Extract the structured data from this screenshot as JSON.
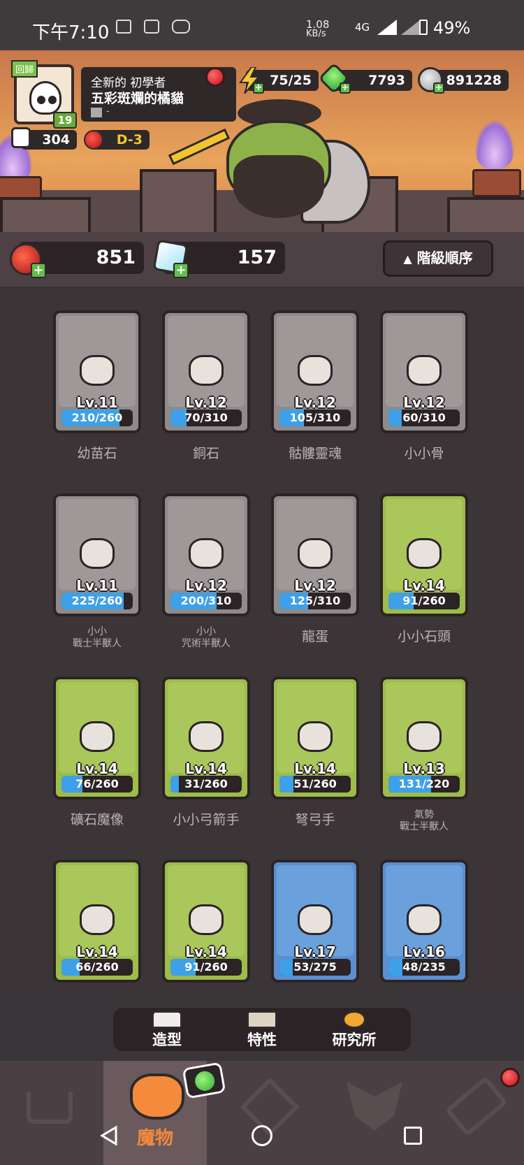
{
  "status_bar": {
    "time": "下午7:10",
    "net_speed": "1.08",
    "net_unit": "KB/s",
    "network": "4G",
    "battery": "49%"
  },
  "profile": {
    "back_badge": "回歸",
    "level": "19",
    "title": "全新的 初學者",
    "name": "五彩斑斕的橘貓",
    "guild": "-",
    "likes": "304",
    "stage": "D-3"
  },
  "currencies": {
    "energy": "75/25",
    "gems": "7793",
    "coins": "891228"
  },
  "resources": {
    "red_orb": "851",
    "crystal": "157",
    "sort_label": "階級順序"
  },
  "cards": [
    {
      "lv": "Lv.11",
      "progress": "210/260",
      "fill": 0.81,
      "name": "幼苗石",
      "color": "gray",
      "icon": "sprout-rock-icon"
    },
    {
      "lv": "Lv.12",
      "progress": "70/310",
      "fill": 0.23,
      "name": "銅石",
      "color": "gray",
      "icon": "crystal-rock-icon"
    },
    {
      "lv": "Lv.12",
      "progress": "105/310",
      "fill": 0.34,
      "name": "骷髏靈魂",
      "color": "gray",
      "icon": "skull-spirit-icon"
    },
    {
      "lv": "Lv.12",
      "progress": "60/310",
      "fill": 0.19,
      "name": "小小骨",
      "color": "gray",
      "icon": "skull-icon"
    },
    {
      "lv": "Lv.11",
      "progress": "225/260",
      "fill": 0.87,
      "name": "小小\n戰士半獸人",
      "color": "gray",
      "icon": "orc-warrior-icon",
      "small": true
    },
    {
      "lv": "Lv.12",
      "progress": "200/310",
      "fill": 0.65,
      "name": "小小\n咒術半獸人",
      "color": "gray",
      "icon": "orc-shaman-icon",
      "small": true
    },
    {
      "lv": "Lv.12",
      "progress": "125/310",
      "fill": 0.4,
      "name": "龍蛋",
      "color": "gray",
      "icon": "dragon-egg-icon"
    },
    {
      "lv": "Lv.14",
      "progress": "91/260",
      "fill": 0.35,
      "name": "小小石頭",
      "color": "green",
      "icon": "stone-icon"
    },
    {
      "lv": "Lv.14",
      "progress": "76/260",
      "fill": 0.29,
      "name": "礦石魔像",
      "color": "green",
      "icon": "ore-golem-icon"
    },
    {
      "lv": "Lv.14",
      "progress": "31/260",
      "fill": 0.12,
      "name": "小小弓箭手",
      "color": "green",
      "icon": "archer-icon"
    },
    {
      "lv": "Lv.14",
      "progress": "51/260",
      "fill": 0.2,
      "name": "弩弓手",
      "color": "green",
      "icon": "crossbow-icon"
    },
    {
      "lv": "Lv.13",
      "progress": "131/220",
      "fill": 0.6,
      "name": "氣勢\n戰士半獸人",
      "color": "green",
      "icon": "orc-berserker-icon",
      "small": true
    },
    {
      "lv": "Lv.14",
      "progress": "66/260",
      "fill": 0.25,
      "name": "",
      "color": "green",
      "icon": "orc-bone-icon"
    },
    {
      "lv": "Lv.14",
      "progress": "91/260",
      "fill": 0.35,
      "name": "",
      "color": "green",
      "icon": "baby-dragon-icon"
    },
    {
      "lv": "Lv.17",
      "progress": "53/275",
      "fill": 0.19,
      "name": "",
      "color": "blue",
      "icon": "sprout-golem-icon"
    },
    {
      "lv": "Lv.16",
      "progress": "48/235",
      "fill": 0.2,
      "name": "",
      "color": "blue",
      "icon": "crystal-golem-icon"
    }
  ],
  "subtabs": [
    "造型",
    "特性",
    "研究所"
  ],
  "nav": {
    "active_label": "魔物"
  }
}
